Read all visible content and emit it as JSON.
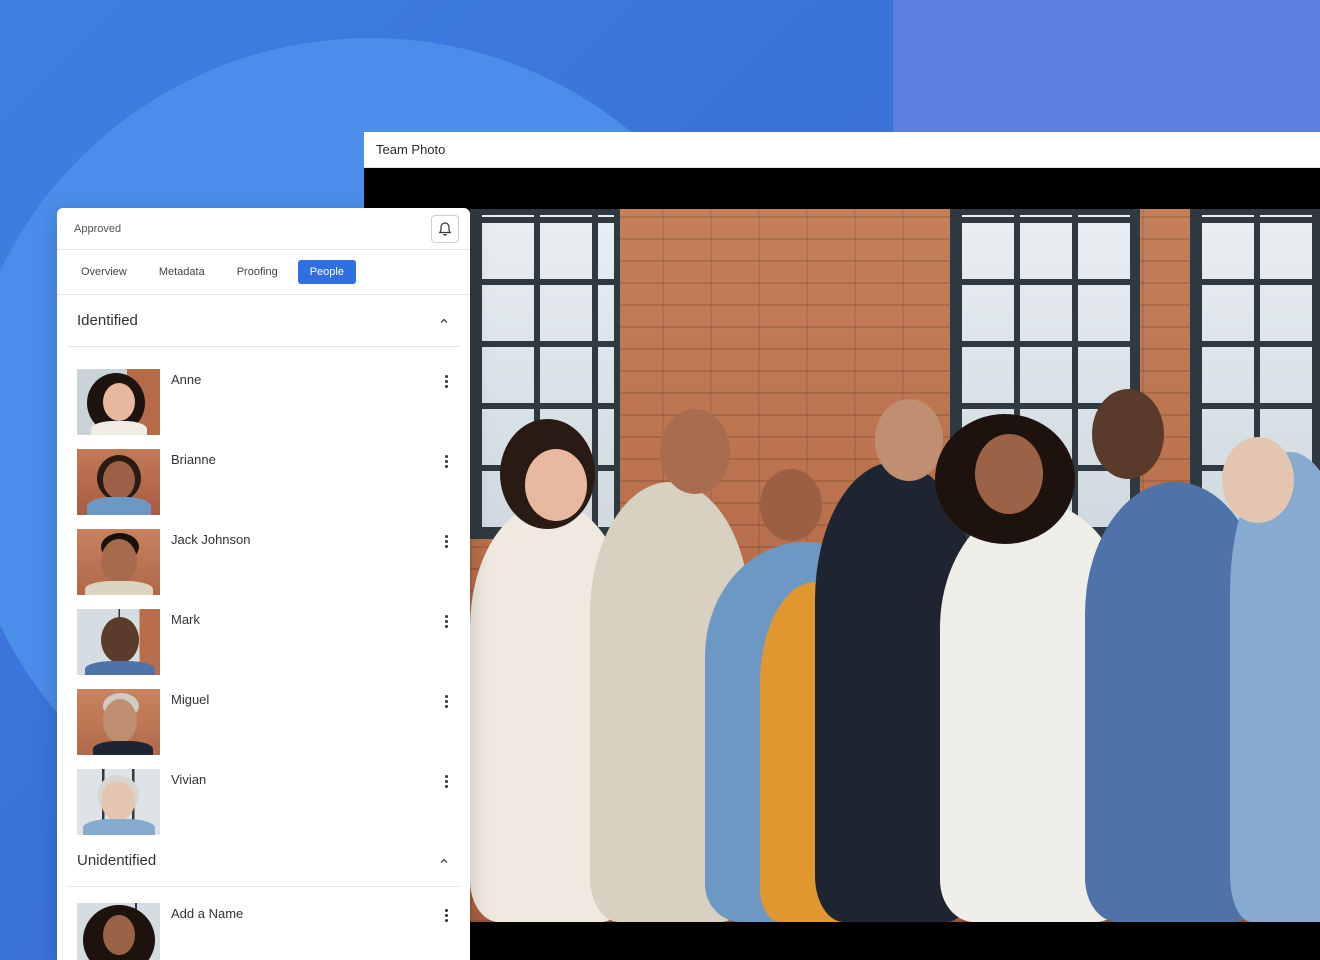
{
  "viewer": {
    "title": "Team Photo"
  },
  "panel": {
    "status": "Approved",
    "tabs": [
      {
        "label": "Overview",
        "active": false
      },
      {
        "label": "Metadata",
        "active": false
      },
      {
        "label": "Proofing",
        "active": false
      },
      {
        "label": "People",
        "active": true
      }
    ],
    "identified": {
      "title": "Identified",
      "people": [
        {
          "name": "Anne"
        },
        {
          "name": "Brianne"
        },
        {
          "name": "Jack Johnson"
        },
        {
          "name": "Mark"
        },
        {
          "name": "Miguel"
        },
        {
          "name": "Vivian"
        }
      ]
    },
    "unidentified": {
      "title": "Unidentified",
      "people": [
        {
          "name": "Add a Name"
        }
      ]
    }
  },
  "colors": {
    "accent": "#2f6fe0",
    "background": "#3f7fe0"
  }
}
